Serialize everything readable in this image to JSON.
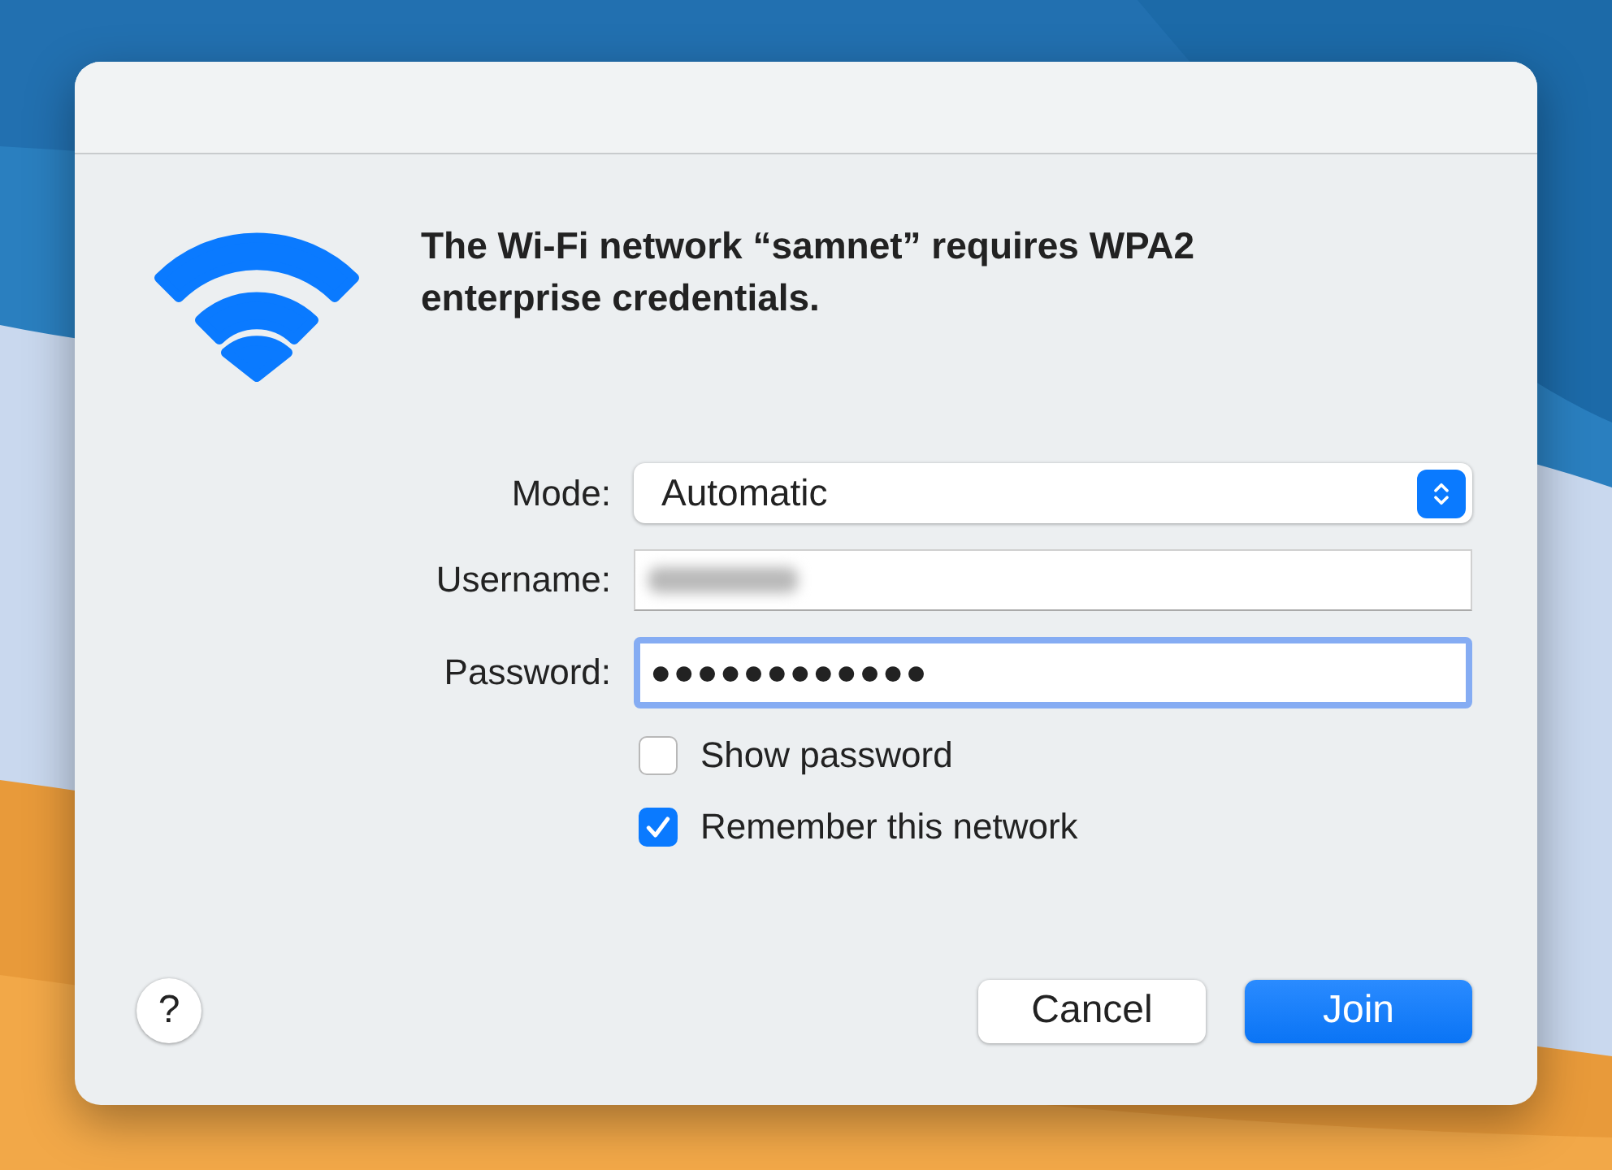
{
  "dialog": {
    "message": "The Wi-Fi network “samnet” requires WPA2 enterprise credentials.",
    "fields": [
      {
        "kind": "popup",
        "label": "Mode:",
        "value": "Automatic"
      },
      {
        "kind": "redacted",
        "label": "Username:"
      },
      {
        "kind": "secure",
        "label": "Password:",
        "value": "●●●●●●●●●●●●",
        "focused": true
      }
    ],
    "checkboxes": [
      {
        "label": "Show password",
        "checked": false
      },
      {
        "label": "Remember this network",
        "checked": true
      }
    ],
    "help": "?",
    "buttons": [
      {
        "label": "Cancel",
        "kind": "default"
      },
      {
        "label": "Join",
        "kind": "primary"
      }
    ]
  }
}
